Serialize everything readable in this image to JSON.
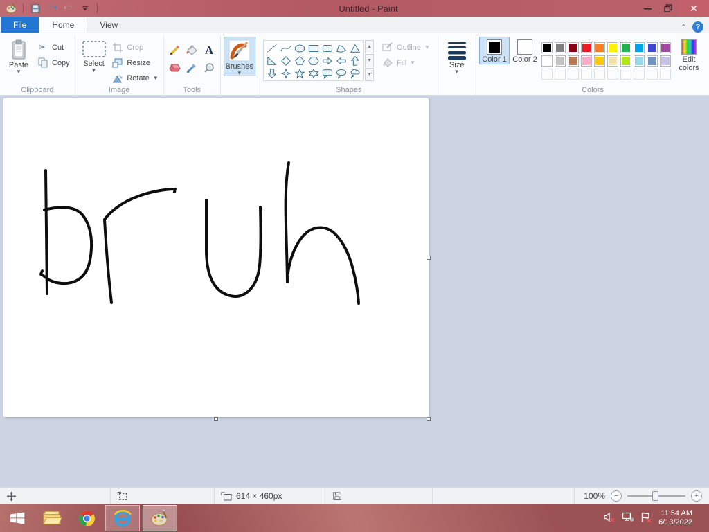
{
  "titlebar": {
    "title": "Untitled - Paint",
    "qat_icons": [
      "paint-app-icon",
      "save-icon",
      "undo-icon",
      "redo-icon",
      "qat-dropdown-icon"
    ],
    "window_controls": [
      "minimize",
      "restore",
      "close"
    ]
  },
  "tabs": {
    "file": "File",
    "home": "Home",
    "view": "View"
  },
  "ribbon": {
    "clipboard": {
      "group_label": "Clipboard",
      "paste": "Paste",
      "cut": "Cut",
      "copy": "Copy"
    },
    "image": {
      "group_label": "Image",
      "select": "Select",
      "crop": "Crop",
      "resize": "Resize",
      "rotate": "Rotate"
    },
    "tools": {
      "group_label": "Tools",
      "icons": [
        "pencil-icon",
        "fill-bucket-icon",
        "text-icon",
        "eraser-icon",
        "eyedropper-icon",
        "magnifier-icon"
      ]
    },
    "brushes": {
      "label": "Brushes"
    },
    "shapes": {
      "group_label": "Shapes",
      "outline": "Outline",
      "fill": "Fill",
      "items": [
        "line",
        "curve",
        "oval",
        "rectangle",
        "rounded-rectangle",
        "polygon",
        "triangle",
        "right-triangle",
        "diamond",
        "pentagon",
        "hexagon",
        "right-arrow",
        "left-arrow",
        "up-arrow",
        "down-arrow",
        "four-point-star",
        "five-point-star",
        "six-point-star",
        "rounded-callout",
        "oval-callout",
        "cloud-callout"
      ]
    },
    "size": {
      "label": "Size"
    },
    "colors": {
      "group_label": "Colors",
      "color1": "Color 1",
      "color2": "Color 2",
      "edit_colors": "Edit colors",
      "color1_value": "#000000",
      "color2_value": "#ffffff",
      "palette_row1": [
        "#000000",
        "#7f7f7f",
        "#880015",
        "#ed1c24",
        "#ff7f27",
        "#fff200",
        "#22b14c",
        "#00a2e8",
        "#3f48cc",
        "#a349a4"
      ],
      "palette_row2": [
        "#ffffff",
        "#c3c3c3",
        "#b97a57",
        "#ffaec9",
        "#ffc90e",
        "#efe4b0",
        "#b5e61d",
        "#99d9ea",
        "#7092be",
        "#c8bfe7"
      ],
      "palette_empty_cells": 10
    }
  },
  "canvas": {
    "drawn_text": "bruh",
    "ink_color": "#0d0d0d",
    "background": "#ffffff"
  },
  "statusbar": {
    "canvas_size": "614 × 460px",
    "zoom_level": "100%"
  },
  "taskbar": {
    "apps": [
      "start",
      "file-explorer",
      "chrome",
      "internet-explorer",
      "paint"
    ],
    "tray_icons": [
      "volume-muted-icon",
      "network-icon",
      "action-center-flag-icon"
    ],
    "time": "11:54 AM",
    "date": "6/13/2022"
  }
}
